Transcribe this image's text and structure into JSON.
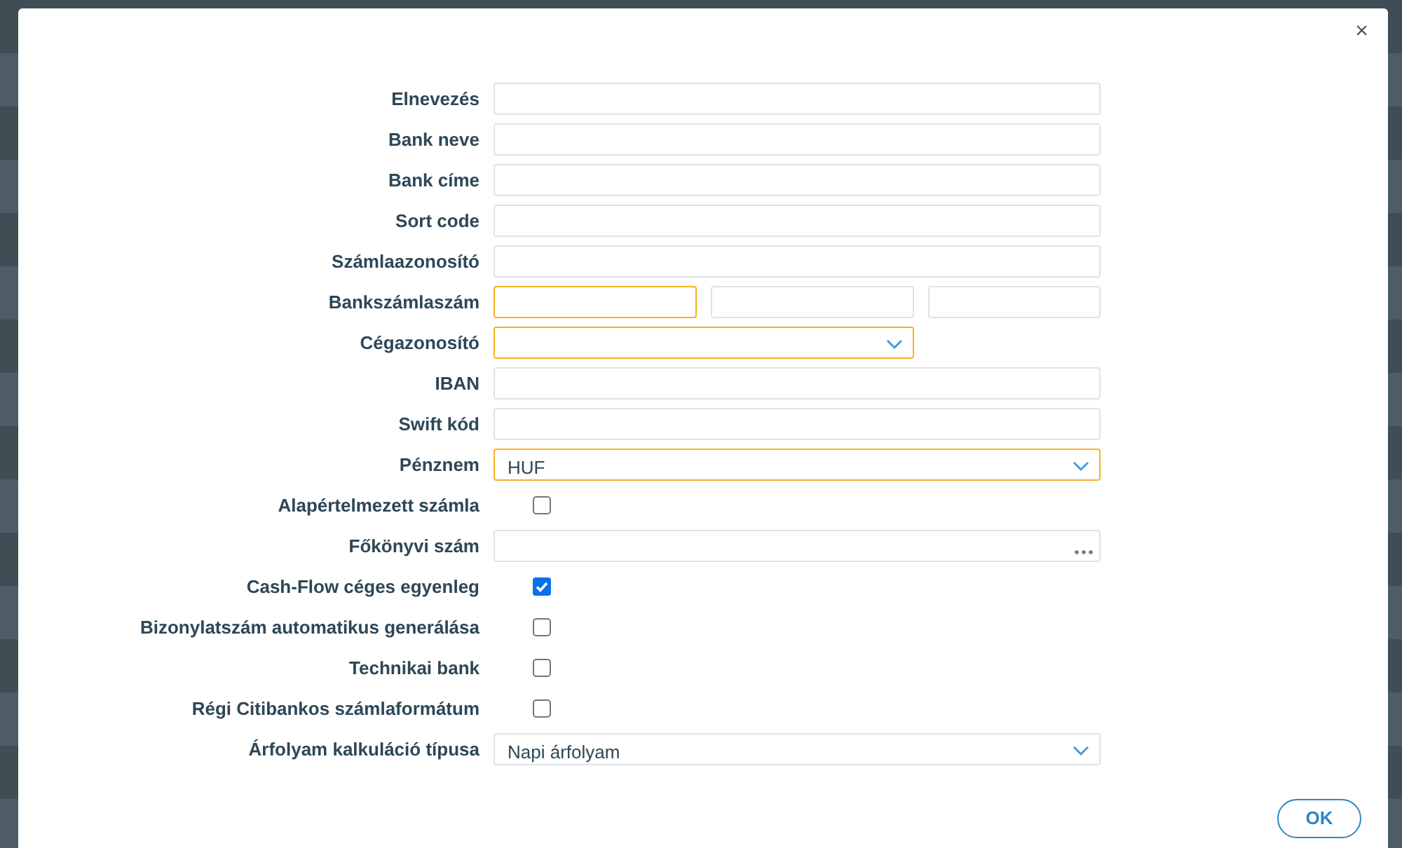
{
  "dialog": {
    "close": "×",
    "button": "OK"
  },
  "fields": [
    {
      "label": "Elnevezés",
      "kind": "text",
      "highlighted": false
    },
    {
      "label": "Bank neve",
      "kind": "text",
      "highlighted": false
    },
    {
      "label": "Bank címe",
      "kind": "text",
      "highlighted": false
    },
    {
      "label": "Sort code",
      "kind": "text",
      "highlighted": false
    },
    {
      "label": "Számlaazonosító",
      "kind": "text",
      "highlighted": false
    },
    {
      "label": "Bankszámlaszám",
      "kind": "split",
      "parts": [
        {
          "highlighted": true
        },
        {
          "highlighted": false
        },
        {
          "highlighted": false
        }
      ]
    },
    {
      "label": "Cégazonosító",
      "kind": "select",
      "narrow": true,
      "highlighted": true
    },
    {
      "label": "IBAN",
      "kind": "text",
      "highlighted": false
    },
    {
      "label": "Swift kód",
      "kind": "text",
      "highlighted": false
    },
    {
      "label": "Pénznem",
      "kind": "select",
      "narrow": false,
      "value": "HUF",
      "highlighted": true
    },
    {
      "label": "Alapértelmezett számla",
      "kind": "checkbox",
      "checked": false
    },
    {
      "label": "Főkönyvi szám",
      "kind": "lookup",
      "highlighted": false
    },
    {
      "label": "Cash-Flow céges egyenleg",
      "kind": "checkbox",
      "checked": true
    },
    {
      "label": "Bizonylatszám automatikus generálása",
      "kind": "checkbox",
      "checked": false
    },
    {
      "label": "Technikai bank",
      "kind": "checkbox",
      "checked": false
    },
    {
      "label": "Régi Citibankos számlaformátum",
      "kind": "checkbox",
      "checked": false
    },
    {
      "label": "Árfolyam kalkuláció típusa",
      "kind": "select",
      "narrow": false,
      "value": "Napi árfolyam",
      "highlighted": false
    }
  ]
}
